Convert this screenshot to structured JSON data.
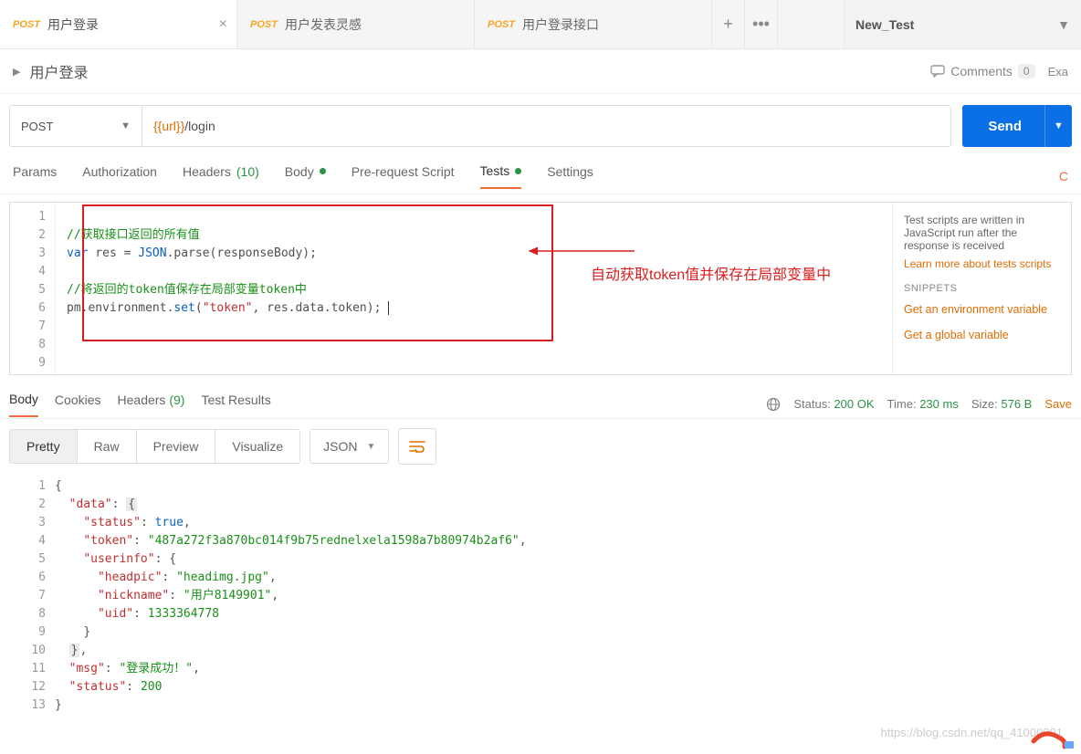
{
  "tabs": [
    {
      "method": "POST",
      "title": "用户登录",
      "active": true
    },
    {
      "method": "POST",
      "title": "用户发表灵感",
      "active": false
    },
    {
      "method": "POST",
      "title": "用户登录接口",
      "active": false
    }
  ],
  "environment": "New_Test",
  "breadcrumb": "用户登录",
  "comments_label": "Comments",
  "comments_count": "0",
  "examples_label": "Exa",
  "request": {
    "method": "POST",
    "url_var": "{{url}}",
    "url_path": "/login",
    "send": "Send"
  },
  "subtabs": {
    "params": "Params",
    "auth": "Authorization",
    "headers": "Headers",
    "headers_count": "(10)",
    "body": "Body",
    "prereq": "Pre-request Script",
    "tests": "Tests",
    "settings": "Settings",
    "cookies_warn": "C"
  },
  "script": {
    "lines": [
      "1",
      "2",
      "3",
      "4",
      "5",
      "6",
      "7",
      "8",
      "9"
    ],
    "l2": "//获取接口返回的所有值",
    "l3_kw": "var",
    "l3_rest_a": " res = ",
    "l3_json": "JSON",
    "l3_rest_b": ".parse(responseBody);",
    "l5": "//将返回的token值保存在局部变量token中",
    "l6_a": "pm.environment.",
    "l6_set": "set",
    "l6_b": "(",
    "l6_str": "\"token\"",
    "l6_c": ", res.data.token);"
  },
  "annotation": "自动获取token值并保存在局部变量中",
  "sidepanel": {
    "desc": "Test scripts are written in JavaScript run after the response is received",
    "learn": "Learn more about tests scripts",
    "heading": "SNIPPETS",
    "s1": "Get an environment variable",
    "s2": "Get a global variable"
  },
  "response_tabs": {
    "body": "Body",
    "cookies": "Cookies",
    "headers": "Headers",
    "headers_count": "(9)",
    "testresults": "Test Results"
  },
  "response_meta": {
    "status_label": "Status:",
    "status_value": "200 OK",
    "time_label": "Time:",
    "time_value": "230 ms",
    "size_label": "Size:",
    "size_value": "576 B",
    "save": "Save"
  },
  "toolbar": {
    "pretty": "Pretty",
    "raw": "Raw",
    "preview": "Preview",
    "visualize": "Visualize",
    "format": "JSON"
  },
  "response_body": {
    "lines": [
      "1",
      "2",
      "3",
      "4",
      "5",
      "6",
      "7",
      "8",
      "9",
      "10",
      "11",
      "12",
      "13"
    ],
    "data_key": "\"data\"",
    "status_key": "\"status\"",
    "status_val": "true",
    "token_key": "\"token\"",
    "token_val": "\"487a272f3a870bc014f9b75rednelxela1598a7b80974b2af6\"",
    "userinfo_key": "\"userinfo\"",
    "headpic_key": "\"headpic\"",
    "headpic_val": "\"headimg.jpg\"",
    "nickname_key": "\"nickname\"",
    "nickname_val": "\"用户8149901\"",
    "uid_key": "\"uid\"",
    "uid_val": "1333364778",
    "msg_key": "\"msg\"",
    "msg_val": "\"登录成功！\"",
    "status2_key": "\"status\"",
    "status2_val": "200"
  },
  "watermark": "https://blog.csdn.net/qq_41000001"
}
